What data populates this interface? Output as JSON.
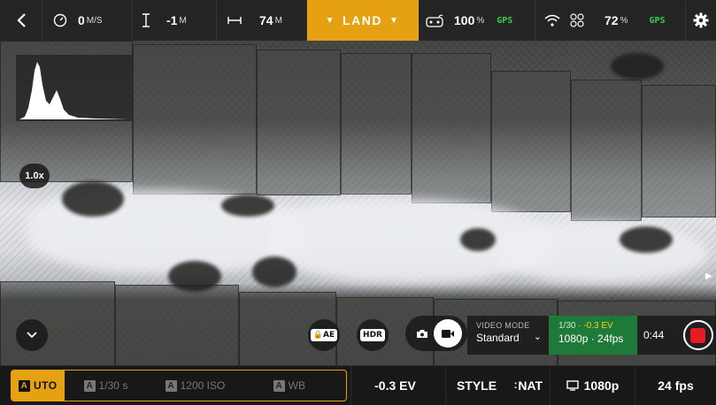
{
  "top_bar": {
    "back_icon": "chevron-left-icon",
    "speed": {
      "icon": "speedometer-icon",
      "value": "0",
      "unit": "M/S"
    },
    "altitude": {
      "icon": "altitude-icon",
      "value": "-1",
      "unit": "M"
    },
    "distance": {
      "icon": "distance-icon",
      "value": "74",
      "unit": "M"
    },
    "land_button": "LAND",
    "controller": {
      "icon": "controller-icon",
      "battery": "100",
      "unit": "%",
      "gps": "GPS"
    },
    "drone": {
      "wifi_icon": "wifi-icon",
      "drone_icon": "drone-icon",
      "battery": "72",
      "unit": "%",
      "gps": "GPS"
    },
    "settings_icon": "gear-icon"
  },
  "histogram": {
    "label_icon": "histogram"
  },
  "zoom": "1.0x",
  "controls": {
    "collapse_icon": "chevron-down-icon",
    "ae_lock": "AE",
    "hdr": "HDR",
    "photo_icon": "camera-icon",
    "video_icon": "video-icon",
    "video_mode_label": "VIDEO MODE",
    "video_mode_value": "Standard",
    "rec_info_shutter": "1/30 · ",
    "rec_info_ev": "-0.3 EV",
    "rec_info_format": "1080p · 24fps",
    "timer": "0:44"
  },
  "bottom_bar": {
    "auto_badge": "A",
    "auto_label": "UTO",
    "shutter_badge": "A",
    "shutter_label": "1/30 s",
    "iso_badge": "A",
    "iso_label": "1200 ISO",
    "wb_badge": "A",
    "wb_label": "WB",
    "ev": "-0.3 EV",
    "style": "STYLE",
    "nat": "NAT",
    "resolution": "1080p",
    "fps": "24 fps"
  },
  "colors": {
    "accent": "#e6a112",
    "gps_green": "#3ccb52",
    "rec_green": "#1f7a3a",
    "record_red": "#e51c25",
    "ev_yellow": "#f2d21b"
  }
}
